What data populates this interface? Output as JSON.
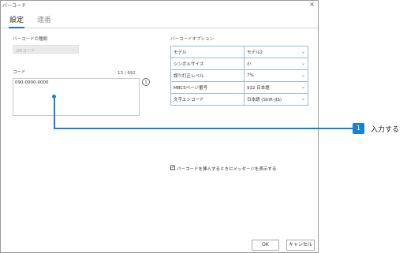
{
  "window": {
    "title": "バーコード",
    "close_glyph": "×"
  },
  "tabs": [
    {
      "label": "設定"
    },
    {
      "label": "連番"
    }
  ],
  "left": {
    "barcode_type_label": "バーコードの種類",
    "barcode_type_value": "QRコード",
    "code_label": "コード",
    "counter": "13 / 692",
    "code_value": "090-0000-0000"
  },
  "options": {
    "header": "バーコードオプション",
    "rows": [
      {
        "key": "モデル",
        "value": "モデル2"
      },
      {
        "key": "シンボルサイズ",
        "value": "小"
      },
      {
        "key": "誤り訂正レベル",
        "value": "7%"
      },
      {
        "key": "MBCSページ番号",
        "value": "932 日本語"
      },
      {
        "key": "文字エンコード",
        "value": "日本語 (Shift-JIS)"
      }
    ]
  },
  "checkbox": {
    "label": "バーコードを挿入するときにメッセージを表示する",
    "checked": true
  },
  "buttons": {
    "ok": "OK",
    "cancel": "キャンセル"
  },
  "callout": {
    "number": "1",
    "text": "入力する"
  },
  "colors": {
    "accent": "#1a7fcf"
  }
}
